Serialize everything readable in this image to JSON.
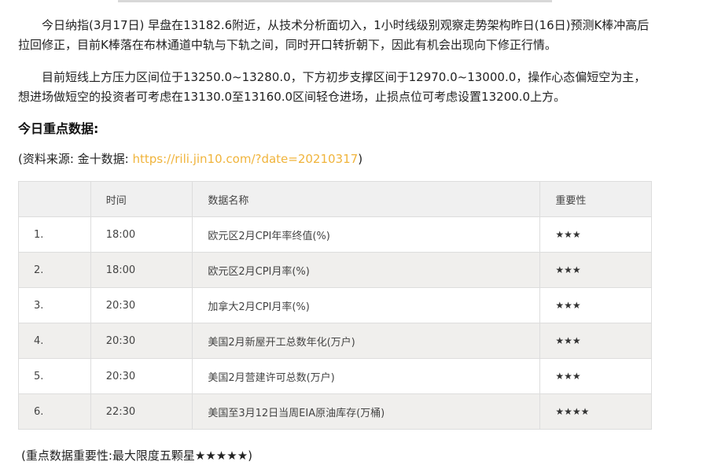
{
  "intro": {
    "p1": "今日纳指(3月17日) 早盘在13182.6附近，从技术分析面切入，1小时线级别观察走势架构昨日(16日)预测K棒冲高后拉回修正，目前K棒落在布林通道中轨与下轨之间，同时开口转折朝下，因此有机会出现向下修正行情。",
    "p2": "目前短线上方压力区间位于13250.0~13280.0，下方初步支撑区间于12970.0~13000.0，操作心态偏短空为主，想进场做短空的投资者可考虑在13130.0至13160.0区间轻仓进场，止损点位可考虑设置13200.0上方。"
  },
  "heading": "今日重点数据:",
  "source": {
    "prefix": "(资料来源: 金十数据: ",
    "link": "https://rili.jin10.com/?date=20210317",
    "suffix": ")"
  },
  "table": {
    "headers": [
      "",
      "时间",
      "数据名称",
      "重要性"
    ],
    "rows": [
      {
        "no": "1.",
        "time": "18:00",
        "name": "欧元区2月CPI年率终值(%)",
        "stars": "★★★"
      },
      {
        "no": "2.",
        "time": "18:00",
        "name": "欧元区2月CPI月率(%)",
        "stars": "★★★"
      },
      {
        "no": "3.",
        "time": "20:30",
        "name": "加拿大2月CPI月率(%)",
        "stars": "★★★"
      },
      {
        "no": "4.",
        "time": "20:30",
        "name": "美国2月新屋开工总数年化(万户)",
        "stars": "★★★"
      },
      {
        "no": "5.",
        "time": "20:30",
        "name": "美国2月营建许可总数(万户)",
        "stars": "★★★"
      },
      {
        "no": "6.",
        "time": "22:30",
        "name": "美国至3月12日当周EIA原油库存(万桶)",
        "stars": "★★★★"
      }
    ]
  },
  "footer": "(重点数据重要性:最大限度五颗星★★★★★)",
  "colors": {
    "link": "#f0b43c",
    "header_bg": "#f0f0f0",
    "stripe_bg": "#f0efed"
  }
}
